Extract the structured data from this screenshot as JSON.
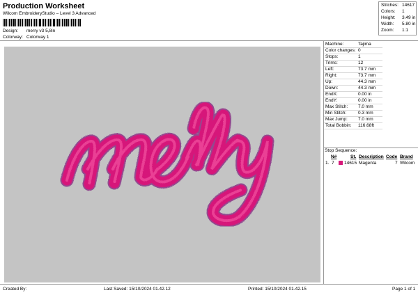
{
  "header": {
    "title": "Production Worksheet",
    "subtitle": "Wilcom EmbroideryStudio – Level 3 Advanced",
    "design_label": "Design:",
    "design_value": "merry v3 5,8in",
    "colorway_label": "Colorway:",
    "colorway_value": "Colorway 1"
  },
  "stats": {
    "stitches_label": "Stitches:",
    "stitches_value": "14617",
    "colors_label": "Colors:",
    "colors_value": "1",
    "height_label": "Height:",
    "height_value": "3.49 in",
    "width_label": "Width:",
    "width_value": "5.80 in",
    "zoom_label": "Zoom:",
    "zoom_value": "1:1"
  },
  "design": {
    "text": "merry",
    "thread_color": "#d6197a",
    "canvas_color": "#c4c4c4"
  },
  "machine": [
    {
      "label": "Machine:",
      "value": "Tajima"
    },
    {
      "label": "Color changes:",
      "value": "0"
    },
    {
      "label": "Stops:",
      "value": "1"
    },
    {
      "label": "Trims:",
      "value": "12"
    },
    {
      "label": "Left:",
      "value": "73.7 mm"
    },
    {
      "label": "Right:",
      "value": "73.7 mm"
    },
    {
      "label": "Up:",
      "value": "44.3 mm"
    },
    {
      "label": "Down:",
      "value": "44.3 mm"
    },
    {
      "label": "EndX:",
      "value": "0.00 in"
    },
    {
      "label": "EndY:",
      "value": "0.00 in"
    },
    {
      "label": "Max Stitch:",
      "value": "7.0 mm"
    },
    {
      "label": "Min Stitch:",
      "value": "0.3 mm"
    },
    {
      "label": "Max Jump:",
      "value": "7.0 mm"
    },
    {
      "label": "Total Bobbin:",
      "value": "116.68ft"
    }
  ],
  "sequence": {
    "title": "Stop Sequence:",
    "headers": {
      "n": "N#",
      "st": "St.",
      "desc": "Description",
      "code": "Code",
      "brand": "Brand"
    },
    "rows": [
      {
        "index": "1.",
        "n": "7",
        "st": "14615",
        "desc": "Magenta",
        "code": "7",
        "brand": "Wilcom",
        "color": "#d6197a"
      }
    ]
  },
  "footer": {
    "created_by": "Created By:",
    "last_saved": "Last Saved: 15/10/2024 01.42.12",
    "printed": "Printed: 15/10/2024 01.42.15",
    "page": "Page 1 of 1"
  }
}
